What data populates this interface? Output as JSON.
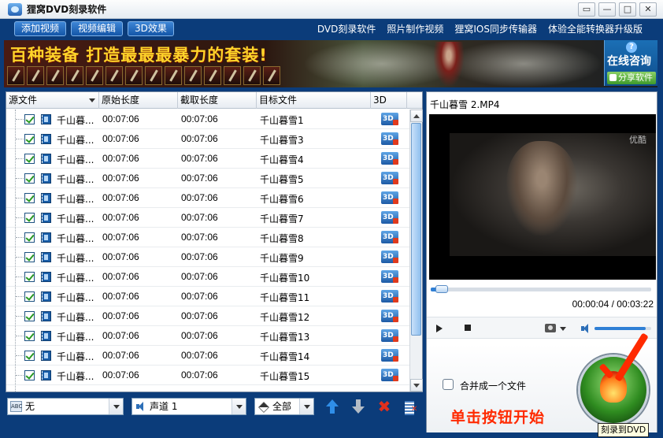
{
  "window": {
    "title": "狸窝DVD刻录软件",
    "buttons": {
      "menu": "▭",
      "minimize": "—",
      "maximize": "□",
      "close": "✕"
    }
  },
  "toolbar": {
    "buttons": [
      "添加视频",
      "视频编辑",
      "3D效果"
    ],
    "links": [
      "DVD刻录软件",
      "照片制作视频",
      "狸窝IOS同步传输器",
      "体验全能转换器升级版"
    ]
  },
  "banner": {
    "headline": "百种装备 打造最最最暴力的套装!",
    "consult_label": "在线咨询",
    "share_label": "分享软件"
  },
  "file_list": {
    "columns": [
      "源文件",
      "原始长度",
      "截取长度",
      "目标文件",
      "3D"
    ],
    "rows": [
      {
        "source": "千山暮...",
        "original": "00:07:06",
        "cut": "00:07:06",
        "target": "千山暮雪1",
        "icon3d": "3D"
      },
      {
        "source": "千山暮...",
        "original": "00:07:06",
        "cut": "00:07:06",
        "target": "千山暮雪3",
        "icon3d": "3D"
      },
      {
        "source": "千山暮...",
        "original": "00:07:06",
        "cut": "00:07:06",
        "target": "千山暮雪4",
        "icon3d": "3D"
      },
      {
        "source": "千山暮...",
        "original": "00:07:06",
        "cut": "00:07:06",
        "target": "千山暮雪5",
        "icon3d": "3D"
      },
      {
        "source": "千山暮...",
        "original": "00:07:06",
        "cut": "00:07:06",
        "target": "千山暮雪6",
        "icon3d": "3D"
      },
      {
        "source": "千山暮...",
        "original": "00:07:06",
        "cut": "00:07:06",
        "target": "千山暮雪7",
        "icon3d": "3D"
      },
      {
        "source": "千山暮...",
        "original": "00:07:06",
        "cut": "00:07:06",
        "target": "千山暮雪8",
        "icon3d": "3D"
      },
      {
        "source": "千山暮...",
        "original": "00:07:06",
        "cut": "00:07:06",
        "target": "千山暮雪9",
        "icon3d": "3D"
      },
      {
        "source": "千山暮...",
        "original": "00:07:06",
        "cut": "00:07:06",
        "target": "千山暮雪10",
        "icon3d": "3D"
      },
      {
        "source": "千山暮...",
        "original": "00:07:06",
        "cut": "00:07:06",
        "target": "千山暮雪11",
        "icon3d": "3D"
      },
      {
        "source": "千山暮...",
        "original": "00:07:06",
        "cut": "00:07:06",
        "target": "千山暮雪12",
        "icon3d": "3D"
      },
      {
        "source": "千山暮...",
        "original": "00:07:06",
        "cut": "00:07:06",
        "target": "千山暮雪13",
        "icon3d": "3D"
      },
      {
        "source": "千山暮...",
        "original": "00:07:06",
        "cut": "00:07:06",
        "target": "千山暮雪14",
        "icon3d": "3D"
      },
      {
        "source": "千山暮...",
        "original": "00:07:06",
        "cut": "00:07:06",
        "target": "千山暮雪15",
        "icon3d": "3D"
      }
    ]
  },
  "bottom_controls": {
    "subtitle_select": "无",
    "audio_select": "声道 1",
    "filter_select": "全部"
  },
  "preview": {
    "title": "千山暮雪 2.MP4",
    "watermark": "优酷",
    "time": "00:00:04 / 00:03:22",
    "seek_fraction": 0.02,
    "volume_fraction": 0.9
  },
  "burn": {
    "merge_label": "合并成一个文件",
    "merge_checked": false,
    "hint": "单击按钮开始",
    "tooltip": "刻录到DVD"
  },
  "colors": {
    "window_bg": "#0b3c7a",
    "accent_blue": "#2f7fd5",
    "hint_red": "#ff2a00",
    "check_green": "#2a9a24"
  }
}
